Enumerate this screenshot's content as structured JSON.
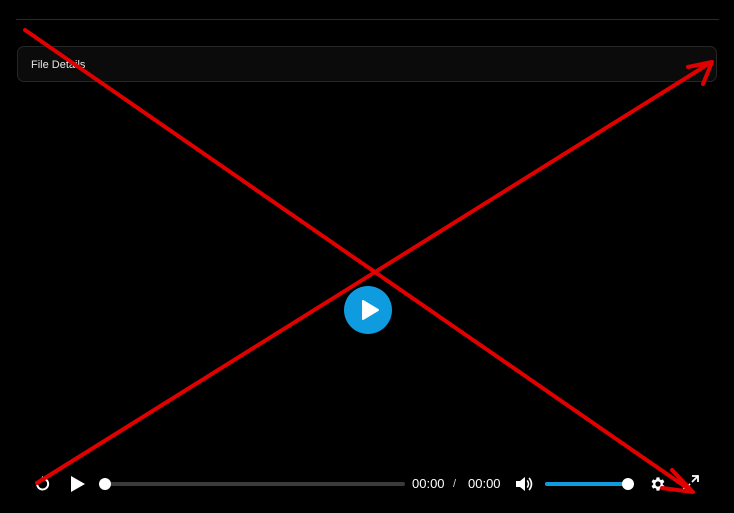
{
  "file_details": {
    "label": "File Details"
  },
  "player": {
    "current_time": "00:00",
    "time_separator": "/",
    "duration": "00:00",
    "progress_fraction": 0,
    "volume_fraction": 1
  },
  "icons": {
    "replay": "replay-icon",
    "play": "play-icon",
    "big_play": "big-play-icon",
    "volume": "volume-icon",
    "settings": "gear-icon",
    "fullscreen": "expand-icon"
  },
  "colors": {
    "accent": "#0f9be0",
    "background": "#000000",
    "annotation": "#e00000"
  }
}
